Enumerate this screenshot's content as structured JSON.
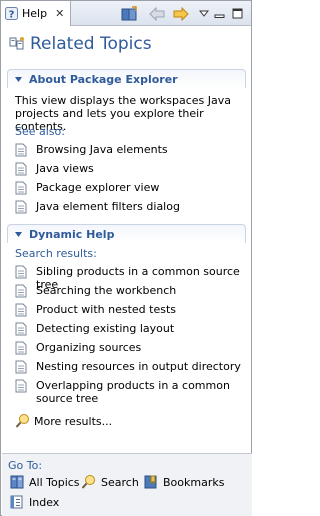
{
  "tab": {
    "label": "Help",
    "close": "✕"
  },
  "toolbar": {
    "colors": {
      "back": "#9aa4b4",
      "forward": "#e8a32a"
    }
  },
  "title": "Related Topics",
  "about": {
    "header": "About Package Explorer",
    "description": "This view displays the workspaces Java projects and lets you explore their contents.",
    "see_also": "See also:",
    "links": [
      "Browsing Java elements",
      "Java views",
      "Package explorer view",
      "Java element filters dialog"
    ]
  },
  "dynamic": {
    "header": "Dynamic Help",
    "search_results": "Search results:",
    "links": [
      "Sibling products in a common source tree",
      "Searching the workbench",
      "Product with nested tests",
      "Detecting existing layout",
      "Organizing sources",
      "Nesting resources in output directory",
      "Overlapping products in a common source tree"
    ],
    "more": "More results..."
  },
  "footer": {
    "goto": "Go To:",
    "all_topics": "All Topics",
    "search": "Search",
    "bookmarks": "Bookmarks",
    "index": "Index"
  },
  "colors": {
    "accent": "#2f5b9b"
  }
}
